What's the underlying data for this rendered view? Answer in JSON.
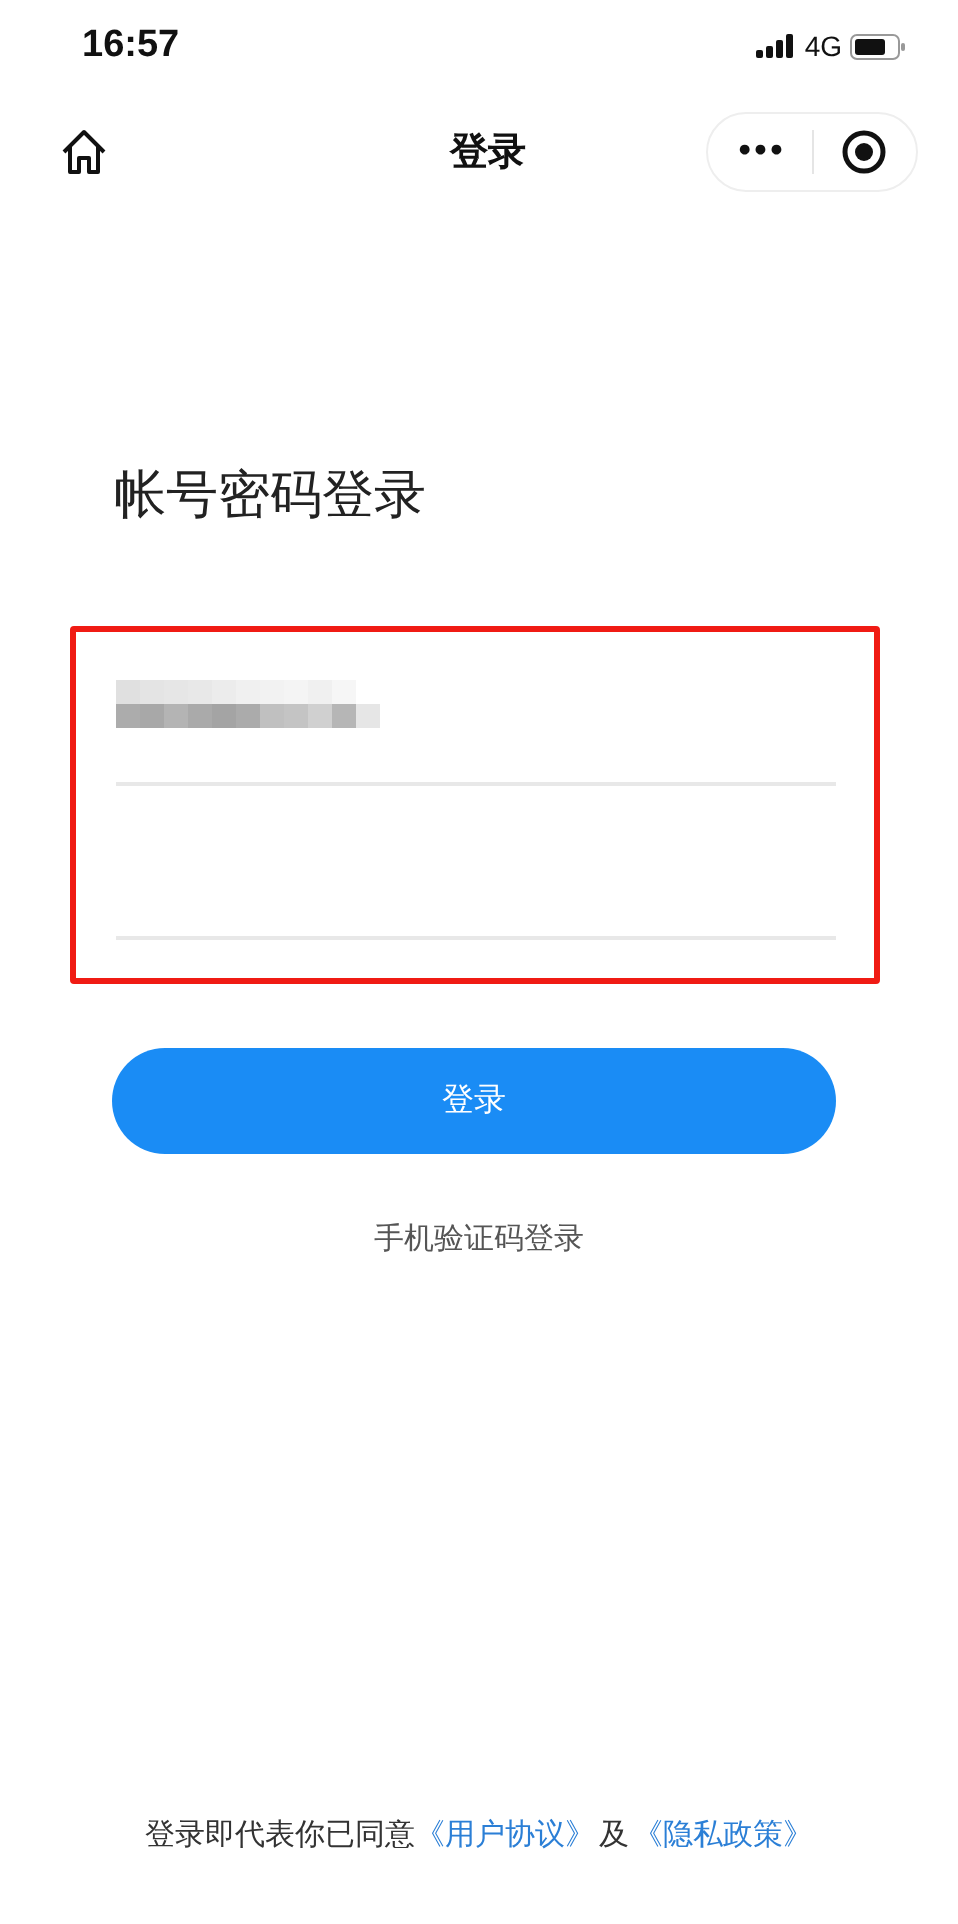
{
  "status_bar": {
    "time": "16:57",
    "network": "4G"
  },
  "nav_bar": {
    "title": "登录",
    "capsule": {
      "more": "•••"
    }
  },
  "heading": "帐号密码登录",
  "form": {
    "highlighted": true,
    "fields": [
      {
        "redacted": true
      },
      {
        "redacted": false
      }
    ]
  },
  "login_button": "登录",
  "alt_login_link": "手机验证码登录",
  "agreement": {
    "text": "登录即代表你已同意",
    "links": [
      {
        "label": "《用户协议》"
      },
      {
        "label": "《隐私政策》"
      }
    ],
    "joiner": "及"
  }
}
